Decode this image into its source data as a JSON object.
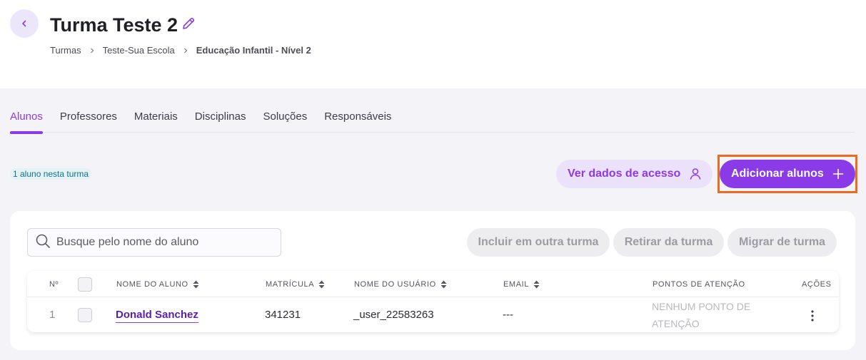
{
  "header": {
    "title": "Turma Teste 2",
    "breadcrumb": [
      "Turmas",
      "Teste-Sua Escola",
      "Educação Infantil - Nível 2"
    ]
  },
  "tabs": [
    {
      "label": "Alunos",
      "active": true
    },
    {
      "label": "Professores",
      "active": false
    },
    {
      "label": "Materiais",
      "active": false
    },
    {
      "label": "Disciplinas",
      "active": false
    },
    {
      "label": "Soluções",
      "active": false
    },
    {
      "label": "Responsáveis",
      "active": false
    }
  ],
  "summary": {
    "count_label": "1 aluno nesta turma"
  },
  "actions": {
    "access_data": "Ver dados de acesso",
    "add_students": "Adicionar alunos"
  },
  "search": {
    "placeholder": "Busque pelo nome do aluno",
    "value": ""
  },
  "bulk_actions": {
    "include": "Incluir em outra turma",
    "remove": "Retirar da turma",
    "migrate": "Migrar de turma"
  },
  "table": {
    "columns": {
      "number": "Nº",
      "name": "NOME DO ALUNO",
      "registration": "MATRÍCULA",
      "username": "NOME DO USUÁRIO",
      "email": "EMAIL",
      "attention": "PONTOS DE ATENÇÃO",
      "actions": "AÇÕES"
    },
    "rows": [
      {
        "number": "1",
        "name": "Donald Sanchez",
        "registration": "341231",
        "username": "_user_22583263",
        "email": "---",
        "attention": "NENHUM PONTO DE ATENÇÃO"
      }
    ]
  },
  "colors": {
    "accent": "#8a3ae6",
    "accent_light": "#ece1fb",
    "highlight_border": "#ef6a1f",
    "background": "#f4f3f8"
  },
  "icons": [
    "chevron-left-icon",
    "pencil-icon",
    "chevron-right-icon",
    "user-icon",
    "plus-icon",
    "search-icon",
    "sort-icon",
    "kebab-icon"
  ]
}
